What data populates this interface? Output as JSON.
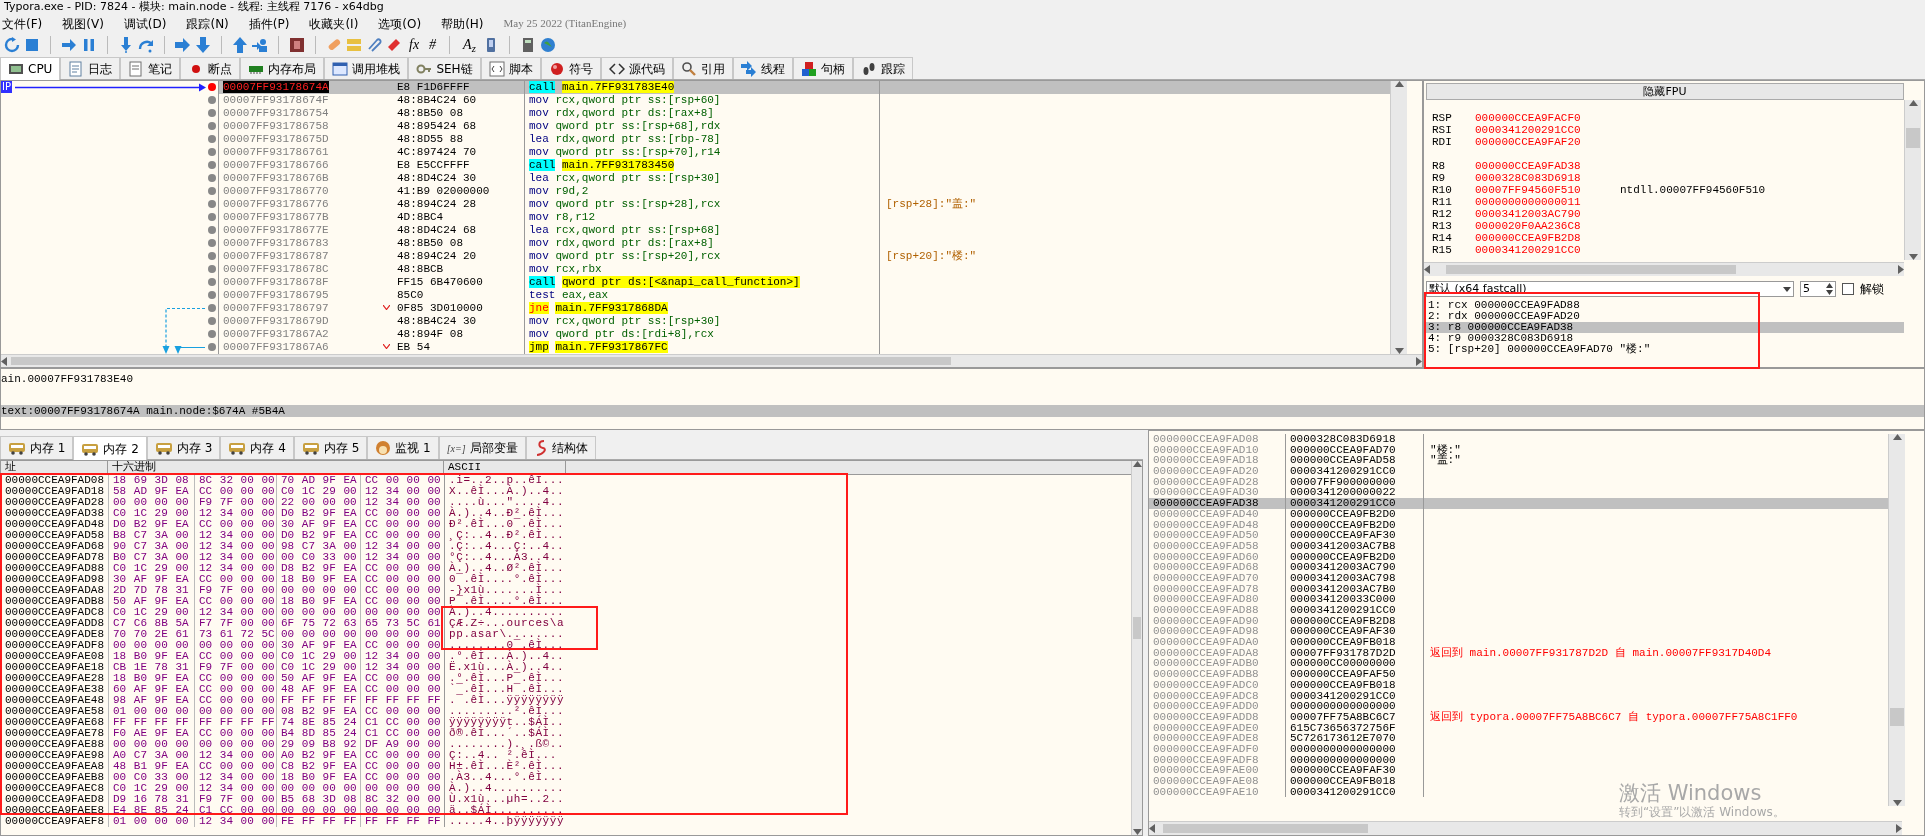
{
  "title": "Typora.exe - PID: 7824 - 模块: main.node - 线程: 主线程 7176 - x64dbg",
  "menu": [
    "文件(F)",
    "视图(V)",
    "调试(D)",
    "跟踪(N)",
    "插件(P)",
    "收藏夹(I)",
    "选项(O)",
    "帮助(H)"
  ],
  "build_info": "May 25 2022 (TitanEngine)",
  "toolbar_text": [
    "fx",
    "#",
    "A$_{z}$"
  ],
  "cpu_tabs": [
    {
      "label": "CPU",
      "selected": true
    },
    {
      "label": "日志",
      "selected": false
    },
    {
      "label": "笔记",
      "selected": false
    },
    {
      "label": "断点",
      "selected": false
    },
    {
      "label": "内存布局",
      "selected": false
    },
    {
      "label": "调用堆栈",
      "selected": false
    },
    {
      "label": "SEH链",
      "selected": false
    },
    {
      "label": "脚本",
      "selected": false
    },
    {
      "label": "符号",
      "selected": false
    },
    {
      "label": "源代码",
      "selected": false
    },
    {
      "label": "引用",
      "selected": false
    },
    {
      "label": "线程",
      "selected": false
    },
    {
      "label": "句柄",
      "selected": false
    },
    {
      "label": "跟踪",
      "selected": false
    }
  ],
  "disassembly": {
    "ip_label": "IP",
    "rows": [
      {
        "address": "00007FF93178674A",
        "bytes": "E8 F1D6FFFF",
        "mnemonic": "call",
        "operands": "main.7FF931783E40",
        "kind": "call",
        "selected": true,
        "breakpoint": true
      },
      {
        "address": "00007FF93178674F",
        "bytes": "48:8B4C24 60",
        "mnemonic": "mov",
        "operands": "rcx,qword ptr ss:[rsp+60]",
        "kind": "plain",
        "selected": false,
        "breakpoint": false
      },
      {
        "address": "00007FF931786754",
        "bytes": "48:8B50 08",
        "mnemonic": "mov",
        "operands": "rdx,qword ptr ds:[rax+8]",
        "kind": "plain",
        "selected": false,
        "breakpoint": false
      },
      {
        "address": "00007FF931786758",
        "bytes": "48:895424 68",
        "mnemonic": "mov",
        "operands": "qword ptr ss:[rsp+68],rdx",
        "kind": "plain",
        "selected": false,
        "breakpoint": false
      },
      {
        "address": "00007FF93178675D",
        "bytes": "48:8D55 88",
        "mnemonic": "lea",
        "operands": "rdx,qword ptr ss:[rbp-78]",
        "kind": "plain",
        "selected": false,
        "breakpoint": false
      },
      {
        "address": "00007FF931786761",
        "bytes": "4C:897424 70",
        "mnemonic": "mov",
        "operands": "qword ptr ss:[rsp+70],r14",
        "kind": "plain",
        "selected": false,
        "breakpoint": false
      },
      {
        "address": "00007FF931786766",
        "bytes": "E8 E5CCFFFF",
        "mnemonic": "call",
        "operands": "main.7FF931783450",
        "kind": "call",
        "selected": false,
        "breakpoint": false
      },
      {
        "address": "00007FF93178676B",
        "bytes": "48:8D4C24 30",
        "mnemonic": "lea",
        "operands": "rcx,qword ptr ss:[rsp+30]",
        "kind": "plain",
        "selected": false,
        "breakpoint": false
      },
      {
        "address": "00007FF931786770",
        "bytes": "41:B9 02000000",
        "mnemonic": "mov",
        "operands": "r9d,2",
        "kind": "plain",
        "selected": false,
        "breakpoint": false
      },
      {
        "address": "00007FF931786776",
        "bytes": "48:894C24 28",
        "mnemonic": "mov",
        "operands": "qword ptr ss:[rsp+28],rcx",
        "comment": "[rsp+28]:\"盖:\"",
        "kind": "plain",
        "selected": false,
        "breakpoint": false
      },
      {
        "address": "00007FF93178677B",
        "bytes": "4D:8BC4",
        "mnemonic": "mov",
        "operands": "r8,r12",
        "kind": "plain",
        "selected": false,
        "breakpoint": false
      },
      {
        "address": "00007FF93178677E",
        "bytes": "48:8D4C24 68",
        "mnemonic": "lea",
        "operands": "rcx,qword ptr ss:[rsp+68]",
        "kind": "plain",
        "selected": false,
        "breakpoint": false
      },
      {
        "address": "00007FF931786783",
        "bytes": "48:8B50 08",
        "mnemonic": "mov",
        "operands": "rdx,qword ptr ds:[rax+8]",
        "kind": "plain",
        "selected": false,
        "breakpoint": false
      },
      {
        "address": "00007FF931786787",
        "bytes": "48:894C24 20",
        "mnemonic": "mov",
        "operands": "qword ptr ss:[rsp+20],rcx",
        "comment": "[rsp+20]:\"楼:\"",
        "kind": "plain",
        "selected": false,
        "breakpoint": false
      },
      {
        "address": "00007FF93178678C",
        "bytes": "48:8BCB",
        "mnemonic": "mov",
        "operands": "rcx,rbx",
        "kind": "plain",
        "selected": false,
        "breakpoint": false
      },
      {
        "address": "00007FF93178678F",
        "bytes": "FF15 6B470600",
        "mnemonic": "call",
        "operands": "qword ptr ds:[<&napi_call_function>]",
        "kind": "call",
        "selected": false,
        "breakpoint": false
      },
      {
        "address": "00007FF931786795",
        "bytes": "85C0",
        "mnemonic": "test",
        "operands": "eax,eax",
        "kind": "plain",
        "selected": false,
        "breakpoint": false
      },
      {
        "address": "00007FF931786797",
        "bytes": "0F85 3D010000",
        "mnemonic": "jne",
        "operands": "main.7FF9317868DA",
        "kind": "branch",
        "selected": false,
        "breakpoint": false
      },
      {
        "address": "00007FF93178679D",
        "bytes": "48:8B4C24 30",
        "mnemonic": "mov",
        "operands": "rcx,qword ptr ss:[rsp+30]",
        "kind": "plain",
        "selected": false,
        "breakpoint": false
      },
      {
        "address": "00007FF9317867A2",
        "bytes": "48:894F 08",
        "mnemonic": "mov",
        "operands": "qword ptr ds:[rdi+8],rcx",
        "kind": "plain",
        "selected": false,
        "breakpoint": false
      },
      {
        "address": "00007FF9317867A6",
        "bytes": "EB 54",
        "mnemonic": "jmp",
        "operands": "main.7FF9317867FC",
        "kind": "jump",
        "selected": false,
        "breakpoint": false
      }
    ]
  },
  "registers": {
    "fpu_button": "隐藏FPU",
    "groups": [
      [
        {
          "name": "RSP",
          "value": "000000CCEA9FACF0"
        },
        {
          "name": "RSI",
          "value": "0000341200291CC0"
        },
        {
          "name": "RDI",
          "value": "000000CCEA9FAF20"
        }
      ],
      [
        {
          "name": "R8",
          "value": "000000CCEA9FAD38"
        },
        {
          "name": "R9",
          "value": "0000328C083D6918"
        },
        {
          "name": "R10",
          "value": "00007FF94560F510",
          "comment": "ntdll.00007FF94560F510"
        },
        {
          "name": "R11",
          "value": "0000000000000011"
        },
        {
          "name": "R12",
          "value": "00003412003AC790"
        },
        {
          "name": "R13",
          "value": "0000020F0AA236C8"
        },
        {
          "name": "R14",
          "value": "000000CCEA9FB2D8"
        },
        {
          "name": "R15",
          "value": "0000341200291CC0"
        }
      ]
    ]
  },
  "calling_convention": {
    "value": "默认 (x64 fastcall)",
    "count": "5",
    "lock_label": "解锁",
    "locked": false
  },
  "arguments": [
    {
      "text": "1: rcx 000000CCEA9FAD88",
      "selected": false
    },
    {
      "text": "2: rdx 000000CCEA9FAD20",
      "selected": false
    },
    {
      "text": "3: r8 000000CCEA9FAD38",
      "selected": true
    },
    {
      "text": "4: r9 0000328C083D6918",
      "selected": false
    },
    {
      "text": "5: [rsp+20] 000000CCEA9FAD70 \"楼:\"",
      "selected": false
    }
  ],
  "info": [
    "ain.00007FF931783E40",
    "text:00007FF93178674A main.node:$674A #5B4A"
  ],
  "memory_tabs": [
    {
      "label": "内存 1",
      "selected": false
    },
    {
      "label": "内存 2",
      "selected": true
    },
    {
      "label": "内存 3",
      "selected": false
    },
    {
      "label": "内存 4",
      "selected": false
    },
    {
      "label": "内存 5",
      "selected": false
    },
    {
      "label": "监视 1",
      "selected": false
    },
    {
      "label": "局部变量",
      "prefix": "[x=]",
      "selected": false
    },
    {
      "label": "结构体",
      "selected": false
    }
  ],
  "dump": {
    "columns": [
      "址",
      "十六进制",
      "ASCII"
    ],
    "rows": [
      {
        "address": "00000CCEA9FAD08",
        "hex": "18 69 3D 08 8C 32 00 00 70 AD 9F EA CC 00 00 00",
        "ascii": ".i=..2..p..êÌ..."
      },
      {
        "address": "00000CCEA9FAD18",
        "hex": "58 AD 9F EA CC 00 00 00 C0 1C 29 00 12 34 00 00",
        "ascii": "X..êÌ...À.)..4.."
      },
      {
        "address": "00000CCEA9FAD28",
        "hex": "00 00 00 00 F9 7F 00 00 22 00 00 00 12 34 00 00",
        "ascii": "....ù...\"....4.."
      },
      {
        "address": "00000CCEA9FAD38",
        "hex": "C0 1C 29 00 12 34 00 00 D0 B2 9F EA CC 00 00 00",
        "ascii": "À.)..4..Ð².êÌ..."
      },
      {
        "address": "00000CCEA9FAD48",
        "hex": "D0 B2 9F EA CC 00 00 00 30 AF 9F EA CC 00 00 00",
        "ascii": "Ð².êÌ...0¯.êÌ..."
      },
      {
        "address": "00000CCEA9FAD58",
        "hex": "B8 C7 3A 00 12 34 00 00 D0 B2 9F EA CC 00 00 00",
        "ascii": "¸Ç:..4..Ð².êÌ..."
      },
      {
        "address": "00000CCEA9FAD68",
        "hex": "90 C7 3A 00 12 34 00 00 98 C7 3A 00 12 34 00 00",
        "ascii": ".Ç:..4...Ç:..4.."
      },
      {
        "address": "00000CCEA9FAD78",
        "hex": "B0 C7 3A 00 12 34 00 00 00 C0 33 00 12 34 00 00",
        "ascii": "°Ç:..4...À3..4.."
      },
      {
        "address": "00000CCEA9FAD88",
        "hex": "C0 1C 29 00 12 34 00 00 D8 B2 9F EA CC 00 00 00",
        "ascii": "À.)..4..Ø².êÌ..."
      },
      {
        "address": "00000CCEA9FAD98",
        "hex": "30 AF 9F EA CC 00 00 00 18 B0 9F EA CC 00 00 00",
        "ascii": "0¯.êÌ....°.êÌ..."
      },
      {
        "address": "00000CCEA9FADA8",
        "hex": "2D 7D 78 31 F9 7F 00 00 00 00 00 00 CC 00 00 00",
        "ascii": "-}x1ù.......Ì..."
      },
      {
        "address": "00000CCEA9FADB8",
        "hex": "50 AF 9F EA CC 00 00 00 18 B0 9F EA CC 00 00 00",
        "ascii": "P¯.êÌ....°.êÌ..."
      },
      {
        "address": "00000CCEA9FADC8",
        "hex": "C0 1C 29 00 12 34 00 00 00 00 00 00 00 00 00 00",
        "ascii": "À.)..4.........."
      },
      {
        "address": "00000CCEA9FADD8",
        "hex": "C7 C6 8B 5A F7 7F 00 00 6F 75 72 63 65 73 5C 61",
        "ascii": "ÇÆ.Z÷...ources\\a"
      },
      {
        "address": "00000CCEA9FADE8",
        "hex": "70 70 2E 61 73 61 72 5C 00 00 00 00 00 00 00 00",
        "ascii": "pp.asar\\........"
      },
      {
        "address": "00000CCEA9FADF8",
        "hex": "00 00 00 00 00 00 00 00 30 AF 9F EA CC 00 00 00",
        "ascii": "........0¯.êÌ..."
      },
      {
        "address": "00000CCEA9FAE08",
        "hex": "18 B0 9F EA CC 00 00 00 C0 1C 29 00 12 34 00 00",
        "ascii": ".°.êÌ...À.)..4.."
      },
      {
        "address": "00000CCEA9FAE18",
        "hex": "CB 1E 78 31 F9 7F 00 00 C0 1C 29 00 12 34 00 00",
        "ascii": "Ë.x1ù...À.)..4.."
      },
      {
        "address": "00000CCEA9FAE28",
        "hex": "18 B0 9F EA CC 00 00 00 50 AF 9F EA CC 00 00 00",
        "ascii": ".°.êÌ...P¯.êÌ..."
      },
      {
        "address": "00000CCEA9FAE38",
        "hex": "60 AF 9F EA CC 00 00 00 48 AF 9F EA CC 00 00 00",
        "ascii": "`¯.êÌ...H¯.êÌ..."
      },
      {
        "address": "00000CCEA9FAE48",
        "hex": "98 AF 9F EA CC 00 00 00 FF FF FF FF FF FF FF FF",
        "ascii": ".¯.êÌ...ÿÿÿÿÿÿÿÿ"
      },
      {
        "address": "00000CCEA9FAE58",
        "hex": "01 00 00 00 00 00 00 00 08 B2 9F EA CC 00 00 00",
        "ascii": ".........².êÌ..."
      },
      {
        "address": "00000CCEA9FAE68",
        "hex": "FF FF FF FF FF FF FF FF 74 8E 85 24 C1 CC 00 00",
        "ascii": "ÿÿÿÿÿÿÿÿt..$ÁÌ.."
      },
      {
        "address": "00000CCEA9FAE78",
        "hex": "F0 AE 9F EA CC 00 00 00 B4 8D 85 24 C1 CC 00 00",
        "ascii": "ð®.êÌ...´..$ÁÌ.."
      },
      {
        "address": "00000CCEA9FAE88",
        "hex": "00 00 00 00 00 00 00 00 29 09 B8 92 DF A9 00 00",
        "ascii": "........).¸.ß©.."
      },
      {
        "address": "00000CCEA9FAE98",
        "hex": "A0 C7 3A 00 12 34 00 00 A0 B2 9F EA CC 00 00 00",
        "ascii": " Ç:..4.. ².êÌ..."
      },
      {
        "address": "00000CCEA9FAEA8",
        "hex": "48 B1 9F EA CC 00 00 00 C8 B2 9F EA CC 00 00 00",
        "ascii": "H±.êÌ...È².êÌ..."
      },
      {
        "address": "00000CCEA9FAEB8",
        "hex": "00 C0 33 00 12 34 00 00 18 B0 9F EA CC 00 00 00",
        "ascii": ".À3..4...°.êÌ..."
      },
      {
        "address": "00000CCEA9FAEC8",
        "hex": "C0 1C 29 00 12 34 00 00 00 00 00 00 00 00 00 00",
        "ascii": "À.)..4.........."
      },
      {
        "address": "00000CCEA9FAED8",
        "hex": "D9 16 78 31 F9 7F 00 00 B5 68 3D 08 8C 32 00 00",
        "ascii": "Ù.x1ù...µh=..2.."
      },
      {
        "address": "00000CCEA9FAEE8",
        "hex": "E4 8E 85 24 C1 CC 00 00 00 00 00 00 00 00 00 00",
        "ascii": "ä..$ÁÌ.........."
      },
      {
        "address": "00000CCEA9FAEF8",
        "hex": "01 00 00 00 12 34 00 00 FE FF FF FF FF FF FF FF",
        "ascii": ".....4..þÿÿÿÿÿÿÿ"
      }
    ]
  },
  "stack": {
    "rows": [
      {
        "address": "000000CCEA9FAD08",
        "value": "0000328C083D6918",
        "selected": false
      },
      {
        "address": "000000CCEA9FAD10",
        "value": "000000CCEA9FAD70",
        "comment": {
          "text": "\"楼:\"",
          "kind": "string"
        },
        "selected": false
      },
      {
        "address": "000000CCEA9FAD18",
        "value": "000000CCEA9FAD58",
        "comment": {
          "text": "\"盖:\"",
          "kind": "string"
        },
        "selected": false
      },
      {
        "address": "000000CCEA9FAD20",
        "value": "0000341200291CC0",
        "selected": false
      },
      {
        "address": "000000CCEA9FAD28",
        "value": "00007FF900000000",
        "selected": false
      },
      {
        "address": "000000CCEA9FAD30",
        "value": "0000341200000022",
        "selected": false
      },
      {
        "address": "000000CCEA9FAD38",
        "value": "0000341200291CC0",
        "selected": true
      },
      {
        "address": "000000CCEA9FAD40",
        "value": "000000CCEA9FB2D0",
        "selected": false
      },
      {
        "address": "000000CCEA9FAD48",
        "value": "000000CCEA9FB2D0",
        "selected": false
      },
      {
        "address": "000000CCEA9FAD50",
        "value": "000000CCEA9FAF30",
        "selected": false
      },
      {
        "address": "000000CCEA9FAD58",
        "value": "00003412003AC7B8",
        "selected": false
      },
      {
        "address": "000000CCEA9FAD60",
        "value": "000000CCEA9FB2D0",
        "selected": false
      },
      {
        "address": "000000CCEA9FAD68",
        "value": "00003412003AC790",
        "selected": false
      },
      {
        "address": "000000CCEA9FAD70",
        "value": "00003412003AC798",
        "selected": false
      },
      {
        "address": "000000CCEA9FAD78",
        "value": "00003412003AC7B0",
        "selected": false
      },
      {
        "address": "000000CCEA9FAD80",
        "value": "000034120033C000",
        "selected": false
      },
      {
        "address": "000000CCEA9FAD88",
        "value": "0000341200291CC0",
        "selected": false
      },
      {
        "address": "000000CCEA9FAD90",
        "value": "000000CCEA9FB2D8",
        "selected": false
      },
      {
        "address": "000000CCEA9FAD98",
        "value": "000000CCEA9FAF30",
        "selected": false
      },
      {
        "address": "000000CCEA9FADA0",
        "value": "000000CCEA9FB018",
        "selected": false
      },
      {
        "address": "000000CCEA9FADA8",
        "value": "00007FF931787D2D",
        "comment": {
          "text": "返回到 main.00007FF931787D2D 自 main.00007FF9317D40D4",
          "kind": "return"
        },
        "selected": false
      },
      {
        "address": "000000CCEA9FADB0",
        "value": "000000CC00000000",
        "selected": false
      },
      {
        "address": "000000CCEA9FADB8",
        "value": "000000CCEA9FAF50",
        "selected": false
      },
      {
        "address": "000000CCEA9FADC0",
        "value": "000000CCEA9FB018",
        "selected": false
      },
      {
        "address": "000000CCEA9FADC8",
        "value": "0000341200291CC0",
        "selected": false
      },
      {
        "address": "000000CCEA9FADD0",
        "value": "0000000000000000",
        "selected": false
      },
      {
        "address": "000000CCEA9FADD8",
        "value": "00007FF75A8BC6C7",
        "comment": {
          "text": "返回到 typora.00007FF75A8BC6C7 自 typora.00007FF75A8C1FF0",
          "kind": "return"
        },
        "selected": false
      },
      {
        "address": "000000CCEA9FADE0",
        "value": "615C73656372756F",
        "selected": false
      },
      {
        "address": "000000CCEA9FADE8",
        "value": "5C726173612E7070",
        "selected": false
      },
      {
        "address": "000000CCEA9FADF0",
        "value": "0000000000000000",
        "selected": false
      },
      {
        "address": "000000CCEA9FADF8",
        "value": "0000000000000000",
        "selected": false
      },
      {
        "address": "000000CCEA9FAE00",
        "value": "000000CCEA9FAF30",
        "selected": false
      },
      {
        "address": "000000CCEA9FAE08",
        "value": "000000CCEA9FB018",
        "selected": false
      },
      {
        "address": "000000CCEA9FAE10",
        "value": "0000341200291CC0",
        "selected": false
      }
    ]
  },
  "activation_notice": {
    "title": "激活 Windows",
    "text": "转到“设置”以激活 Windows。"
  }
}
